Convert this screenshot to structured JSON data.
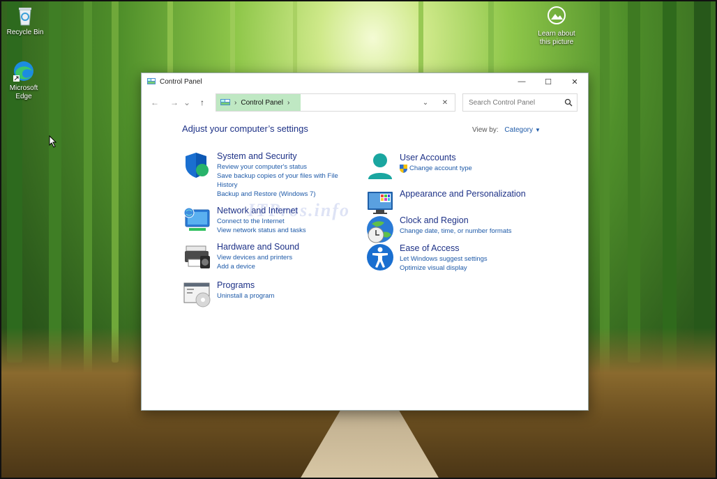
{
  "desktop": {
    "icons": [
      {
        "label": "Recycle Bin",
        "icon": "recycle-bin-icon"
      },
      {
        "label": "Microsoft Edge",
        "icon": "edge-icon"
      },
      {
        "label": "Learn about this picture",
        "icon": "spotlight-icon"
      }
    ]
  },
  "window": {
    "title": "Control Panel",
    "controls": {
      "minimize": "—",
      "maximize": "☐",
      "close": "✕"
    },
    "nav": {
      "back": "←",
      "forward": "→",
      "recent": "⌄",
      "up": "↑"
    },
    "address": {
      "crumb": "Control Panel",
      "sep1": "›",
      "sep2": "›",
      "dropdown": "⌄",
      "clear": "✕"
    },
    "search": {
      "placeholder": "Search Control Panel"
    },
    "heading": "Adjust your computer’s settings",
    "view_by": {
      "label": "View by:",
      "value": "Category"
    },
    "watermark": "ITPros.info",
    "categories": [
      {
        "title": "System and Security",
        "icon": "shield-icon",
        "links": [
          "Review your computer's status",
          "Save backup copies of your files with File",
          "History",
          "Backup and Restore (Windows 7)"
        ]
      },
      {
        "title": "Network and Internet",
        "icon": "network-globe-icon",
        "links": [
          "Connect to the Internet",
          "View network status and tasks"
        ]
      },
      {
        "title": "Hardware and Sound",
        "icon": "printer-icon",
        "links": [
          "View devices and printers",
          "Add a device"
        ]
      },
      {
        "title": "Programs",
        "icon": "programs-icon",
        "links": [
          "Uninstall a program"
        ]
      },
      {
        "title": "User Accounts",
        "icon": "user-icon",
        "links": [
          "Change account type"
        ]
      },
      {
        "title": "Appearance and Personalization",
        "icon": "monitor-palette-icon",
        "links": []
      },
      {
        "title": "Clock and Region",
        "icon": "clock-globe-icon",
        "links": [
          "Change date, time, or number formats"
        ]
      },
      {
        "title": "Ease of Access",
        "icon": "accessibility-icon",
        "links": [
          "Let Windows suggest settings",
          "Optimize visual display"
        ]
      }
    ]
  },
  "colors": {
    "link": "#1e5aa8",
    "title": "#1e3287",
    "breadcrumb_highlight": "#bfe8c3"
  }
}
